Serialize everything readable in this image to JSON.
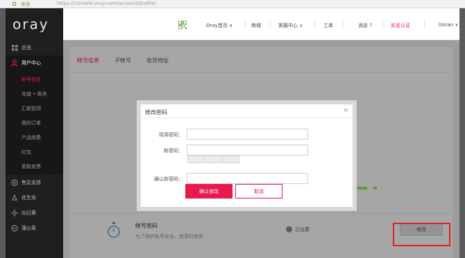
{
  "browser": {
    "secure_label": "安全",
    "url": "https://console.oray.com/account/profile/"
  },
  "logo": {
    "text": "oray"
  },
  "sidebar": {
    "items": [
      {
        "label": "总览",
        "icon": "grid-icon"
      },
      {
        "label": "用户中心",
        "icon": "user-icon"
      }
    ],
    "sub_items": [
      {
        "label": "帐号信息"
      },
      {
        "label": "充值 • 账务"
      },
      {
        "label": "汇款招领"
      },
      {
        "label": "我的订单"
      },
      {
        "label": "产品续费"
      },
      {
        "label": "红包"
      },
      {
        "label": "索取发票"
      }
    ],
    "bottom_items": [
      {
        "label": "售后支持",
        "icon": "support-icon"
      },
      {
        "label": "花生壳",
        "icon": "peanut-icon"
      },
      {
        "label": "向日葵",
        "icon": "sunflower-icon"
      },
      {
        "label": "蒲公英",
        "icon": "dandelion-icon"
      }
    ]
  },
  "header": {
    "nav": [
      {
        "label": "Oray首页 ∨"
      },
      {
        "label": "商城"
      },
      {
        "label": "客服中心 ∨"
      },
      {
        "label": "工单"
      },
      {
        "label": "消息",
        "badge": "7"
      },
      {
        "label": "实名认证"
      },
      {
        "label": "liziran ∨"
      }
    ]
  },
  "tabs": [
    {
      "label": "帐号信息"
    },
    {
      "label": "子帐号"
    },
    {
      "label": "收货地址"
    }
  ],
  "password_row": {
    "title": "帐号密码",
    "desc": "为了保护帐号安全，登录时使用",
    "status": "已设置",
    "modify_label": "修改"
  },
  "dialog": {
    "title": "修改密码",
    "close": "×",
    "current_label": "现用密码：",
    "new_label": "新密码：",
    "confirm_label": "确认新密码：",
    "confirm_button": "确认修改",
    "cancel_button": "取消"
  },
  "colors": {
    "accent": "#e8194c",
    "sidebar_bg": "#1f1f1f",
    "highlight": "#e02020"
  }
}
